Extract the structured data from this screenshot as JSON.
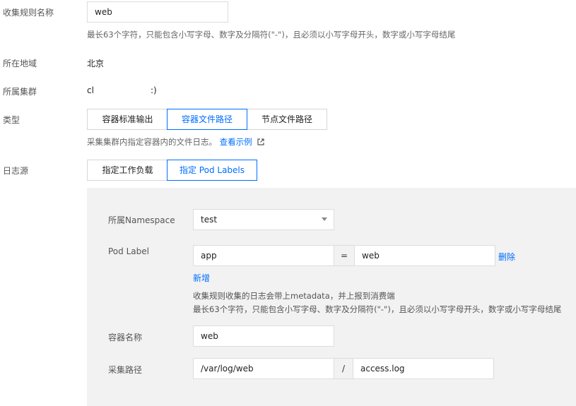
{
  "rule_name": {
    "label": "收集规则名称",
    "value": "web",
    "hint": "最长63个字符，只能包含小写字母、数字及分隔符(\"-\")，且必须以小写字母开头，数字或小写字母结尾"
  },
  "region": {
    "label": "所在地域",
    "value": "北京"
  },
  "cluster": {
    "label": "所属集群",
    "value_prefix": "cl",
    "value_suffix": ":)"
  },
  "type": {
    "label": "类型",
    "options": [
      "容器标准输出",
      "容器文件路径",
      "节点文件路径"
    ],
    "selected": "容器文件路径",
    "hint": "采集集群内指定容器内的文件日志。",
    "example_link": "查看示例"
  },
  "log_source": {
    "label": "日志源",
    "options": [
      "指定工作负载",
      "指定 Pod Labels"
    ],
    "selected": "指定 Pod Labels"
  },
  "panel": {
    "namespace": {
      "label": "所属Namespace",
      "value": "test"
    },
    "pod_label": {
      "label": "Pod Label",
      "key": "app",
      "operator": "=",
      "value": "web",
      "delete": "删除",
      "add": "新增",
      "hint1": "收集规则收集的日志会带上metadata，并上报到消费端",
      "hint2": "最长63个字符，只能包含小写字母、数字及分隔符(\"-\")，且必须以小写字母开头，数字或小写字母结尾"
    },
    "container_name": {
      "label": "容器名称",
      "value": "web"
    },
    "path": {
      "label": "采集路径",
      "dir": "/var/log/web",
      "separator": "/",
      "file": "access.log"
    }
  }
}
